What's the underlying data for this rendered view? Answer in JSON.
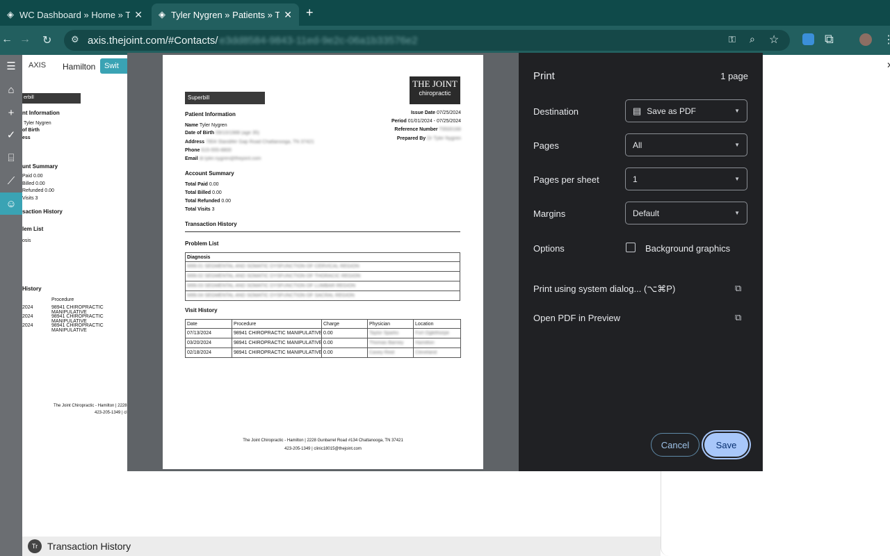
{
  "browser": {
    "tabs": [
      {
        "title": "WC Dashboard » Home » The",
        "active": false
      },
      {
        "title": "Tyler Nygren » Patients » The",
        "active": true
      }
    ],
    "url_host": "axis.thejoint.com/#Contacts/",
    "url_hidden": "e3dd8584-9843-11ed-9e2c-06a1b33576e2"
  },
  "app": {
    "logo": "AXIS",
    "location": "Hamilton",
    "switch_label": "Swit",
    "status_badge": "Tr",
    "status_title": "Transaction History"
  },
  "bg_doc": {
    "superbill": "erbill",
    "patient_info": "nt Information",
    "name_row": "Tyler Nygren",
    "dob_label": "of Birth",
    "address_label": "ess",
    "account_summary": "unt Summary",
    "paid": "Paid 0.00",
    "billed": "Billed 0.00",
    "refunded": "Refunded 0.00",
    "visits": "Visits 3",
    "transaction_history": "saction History",
    "problem_list": "lem List",
    "diag_header": "osis",
    "history": "History",
    "proc_header": "Procedure",
    "rows": [
      {
        "date": "2024",
        "proc": "98941 CHIROPRACTIC MANIPULATIVE"
      },
      {
        "date": "2024",
        "proc": "98941 CHIROPRACTIC MANIPULATIVE"
      },
      {
        "date": "2024",
        "proc": "98941 CHIROPRACTIC MANIPULATIVE"
      }
    ],
    "footer1": "The Joint Chiropractic - Hamilton | 2228",
    "footer2": "423-205-1349 | cli"
  },
  "sheet": {
    "superbill": "Superbill",
    "logo_line1": "THE JOINT",
    "logo_line2": "chiropractic",
    "patient_info": "Patient Information",
    "name_label": "Name",
    "name_value": "Tyler Nygren",
    "dob_label": "Date of Birth",
    "dob_value": "09/10/1988 (age 35)",
    "address_label": "Address",
    "address_value": "7804 Standifer Gap Road Chattanooga, TN 37421",
    "phone_label": "Phone",
    "phone_value": "615-555-8800",
    "email_label": "Email",
    "email_value": "dr.tyler.nygren@thejoint.com",
    "issue_label": "Issue Date",
    "issue_value": "07/25/2024",
    "period_label": "Period",
    "period_value": "01/01/2024 - 07/25/2024",
    "ref_label": "Reference Number",
    "ref_value": "T9500166",
    "prepared_label": "Prepared By",
    "prepared_value": "Dr Tyler Nygren",
    "account_summary": "Account Summary",
    "total_paid_label": "Total Paid",
    "total_paid": "0.00",
    "total_billed_label": "Total Billed",
    "total_billed": "0.00",
    "total_refunded_label": "Total Refunded",
    "total_refunded": "0.00",
    "total_visits_label": "Total Visits",
    "total_visits": "3",
    "transaction_history": "Transaction History",
    "problem_list": "Problem List",
    "diagnosis_header": "Diagnosis",
    "diagnoses": [
      "M99.01 SEGMENTAL AND SOMATIC DYSFUNCTION OF CERVICAL REGION",
      "M99.02 SEGMENTAL AND SOMATIC DYSFUNCTION OF THORACIC REGION",
      "M99.03 SEGMENTAL AND SOMATIC DYSFUNCTION OF LUMBAR REGION",
      "M99.04 SEGMENTAL AND SOMATIC DYSFUNCTION OF SACRAL REGION"
    ],
    "visit_history": "Visit History",
    "visit_headers": [
      "Date",
      "Procedure",
      "Charge",
      "Physician",
      "Location"
    ],
    "visits": [
      {
        "date": "07/13/2024",
        "procedure": "98941 CHIROPRACTIC MANIPULATIVE T",
        "charge": "0.00",
        "physician": "Taylor Sparks",
        "location": "Fort Oglethorpe"
      },
      {
        "date": "03/20/2024",
        "procedure": "98941 CHIROPRACTIC MANIPULATIVE T",
        "charge": "0.00",
        "physician": "Thomas Barney",
        "location": "Hamilton"
      },
      {
        "date": "02/18/2024",
        "procedure": "98941 CHIROPRACTIC MANIPULATIVE T",
        "charge": "0.00",
        "physician": "Casey Reid",
        "location": "Cleveland"
      }
    ],
    "footer1": "The Joint Chiropractic - Hamilton | 2228 Gunbarrel Road #134 Chattanooga, TN 37421",
    "footer2": "423-205-1349 | clinic18015@thejoint.com"
  },
  "print": {
    "title": "Print",
    "page_count": "1 page",
    "destination_label": "Destination",
    "destination_value": "Save as PDF",
    "pages_label": "Pages",
    "pages_value": "All",
    "pps_label": "Pages per sheet",
    "pps_value": "1",
    "margins_label": "Margins",
    "margins_value": "Default",
    "options_label": "Options",
    "bg_graphics_label": "Background graphics",
    "system_dialog_label": "Print using system dialog... (⌥⌘P)",
    "open_preview_label": "Open PDF in Preview",
    "cancel_label": "Cancel",
    "save_label": "Save"
  }
}
